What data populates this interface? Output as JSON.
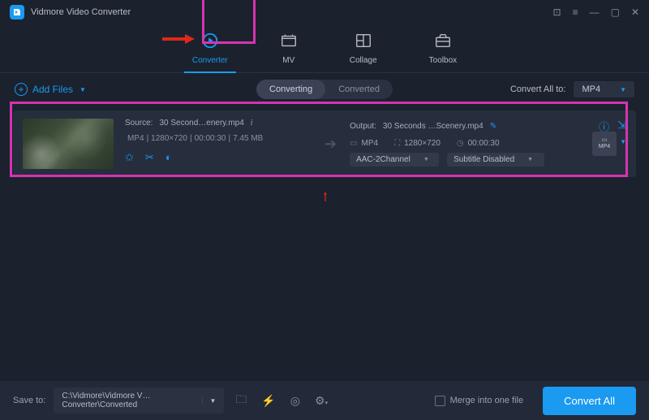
{
  "app": {
    "title": "Vidmore Video Converter"
  },
  "nav": {
    "tabs": [
      {
        "label": "Converter"
      },
      {
        "label": "MV"
      },
      {
        "label": "Collage"
      },
      {
        "label": "Toolbox"
      }
    ]
  },
  "toolbar": {
    "addfiles": "Add Files",
    "segments": [
      {
        "label": "Converting"
      },
      {
        "label": "Converted"
      }
    ],
    "convert_all_to": "Convert All to:",
    "format": "MP4"
  },
  "item": {
    "source_label": "Source:",
    "source_file": "30 Second…enery.mp4",
    "format": "MP4",
    "resolution": "1280×720",
    "duration": "00:00:30",
    "filesize": "7.45 MB",
    "output_label": "Output:",
    "output_file": "30 Seconds …Scenery.mp4",
    "out_format": "MP4",
    "out_resolution": "1280×720",
    "out_duration": "00:00:30",
    "audio": "AAC-2Channel",
    "subtitle": "Subtitle Disabled",
    "badge": "MP4"
  },
  "bottom": {
    "save_to": "Save to:",
    "path": "C:\\Vidmore\\Vidmore V… Converter\\Converted",
    "merge": "Merge into one file",
    "convert": "Convert All"
  }
}
